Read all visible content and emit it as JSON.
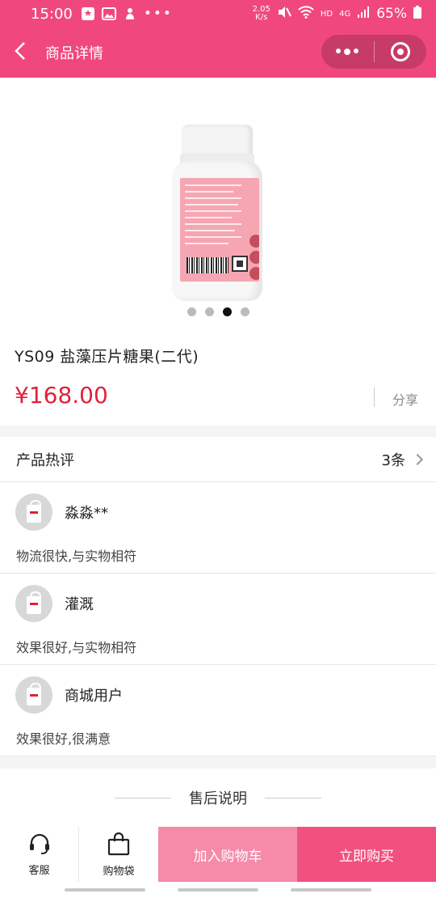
{
  "status_bar": {
    "time": "15:00",
    "net_speed_top": "2.05",
    "net_speed_bottom": "K/s",
    "network": "HD",
    "signal_label": "4G",
    "battery": "65%"
  },
  "navbar": {
    "title": "商品详情"
  },
  "gallery": {
    "slide_count": 4,
    "active_slide": 3
  },
  "product": {
    "name": "YS09 盐藻压片糖果(二代)",
    "price": "¥168.00",
    "share_label": "分享"
  },
  "reviews": {
    "title": "产品热评",
    "count": "3条",
    "items": [
      {
        "user": "淼淼**",
        "text": "物流很快,与实物相符"
      },
      {
        "user": "灌溉",
        "text": "效果很好,与实物相符"
      },
      {
        "user": "商城用户",
        "text": "效果很好,很满意"
      }
    ]
  },
  "after_sales": {
    "title": "售后说明"
  },
  "bottom_bar": {
    "customer_service": "客服",
    "shopping_bag": "购物袋",
    "add_to_cart": "加入购物车",
    "buy_now": "立即购买"
  },
  "colors": {
    "brand": "#f0487e",
    "price": "#e0223a",
    "cart_button": "#f68aa9",
    "buy_button": "#f0517f"
  }
}
